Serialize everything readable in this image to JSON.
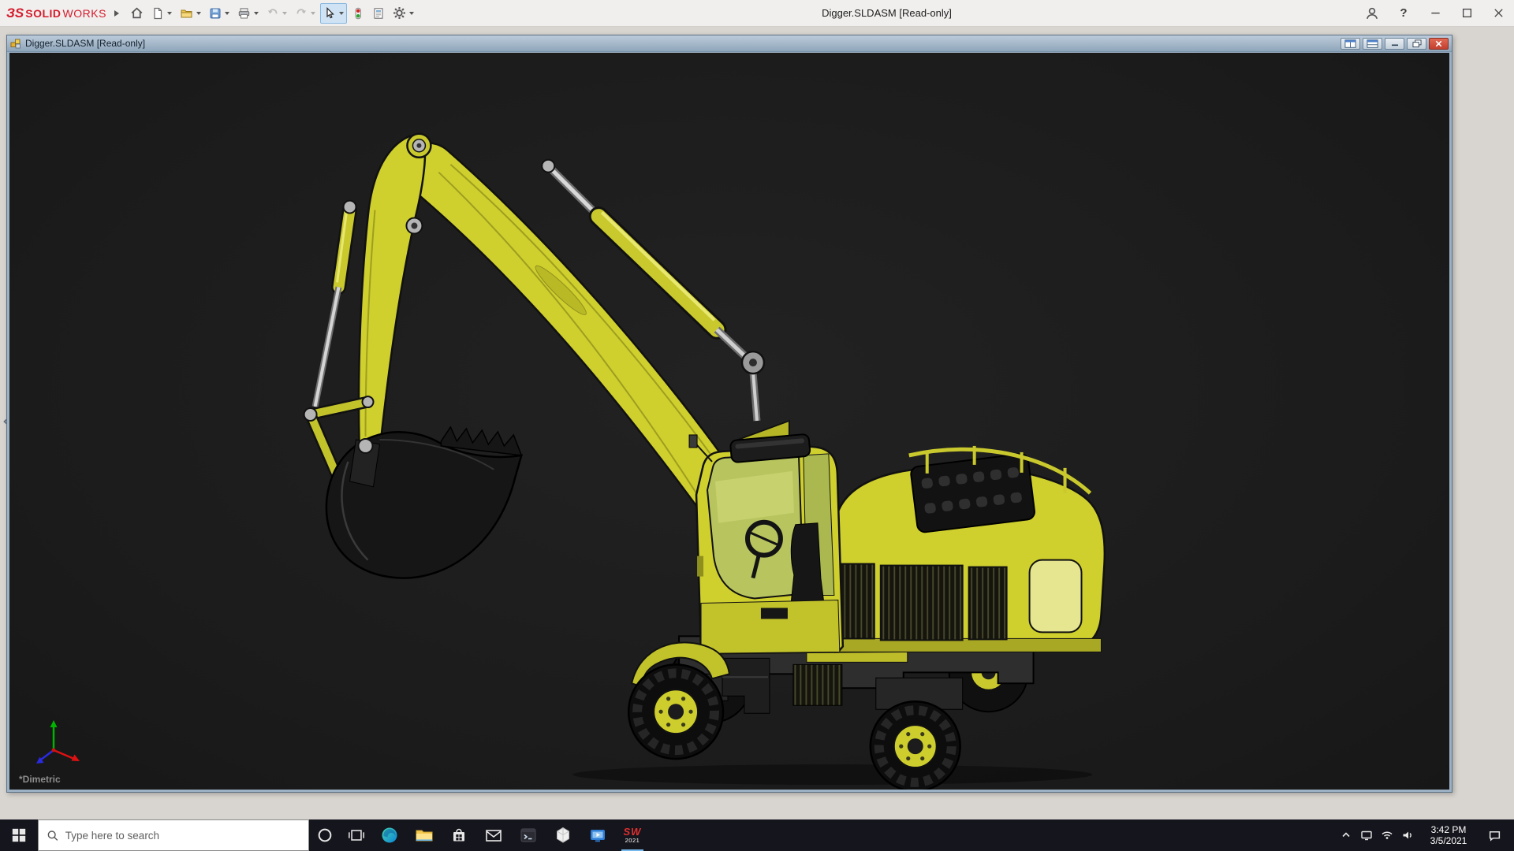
{
  "app": {
    "brand": {
      "mark": "ЗS",
      "name_bold": "SOLID",
      "name_light": "WORKS"
    },
    "title": "Digger.SLDASM [Read-only]",
    "help_glyph": "?",
    "toolbar_icons": [
      "home-icon",
      "new-document-icon",
      "open-icon",
      "save-icon",
      "print-icon",
      "undo-icon",
      "redo-icon",
      "select-cursor-icon",
      "rebuild-icon",
      "file-properties-icon",
      "options-gear-icon"
    ]
  },
  "doc": {
    "title": "Digger.SLDASM [Read-only]",
    "view_orientation": "*Dimetric"
  },
  "taskbar": {
    "search_placeholder": "Type here to search",
    "time": "3:42 PM",
    "date": "3/5/2021",
    "solidworks_glyph": "SW",
    "solidworks_year": "2021",
    "pinned_icons": [
      "cortana-icon",
      "task-view-icon",
      "edge-icon",
      "file-explorer-icon",
      "store-icon",
      "mail-icon",
      "command-prompt-icon",
      "3d-viewer-icon",
      "movies-tv-icon",
      "solidworks-icon"
    ],
    "tray_icons": [
      "hidden-icons-chevron",
      "display-icon",
      "wifi-icon",
      "volume-icon",
      "action-center-icon"
    ]
  },
  "colors": {
    "model_yellow": "#cfcf2e",
    "viewport_bg": "#1d1d1d",
    "taskbar_bg": "#15151d",
    "doc_titlebar_blue": "#9db1c5",
    "close_red": "#c33f2d",
    "brand_red": "#d41c2c"
  }
}
